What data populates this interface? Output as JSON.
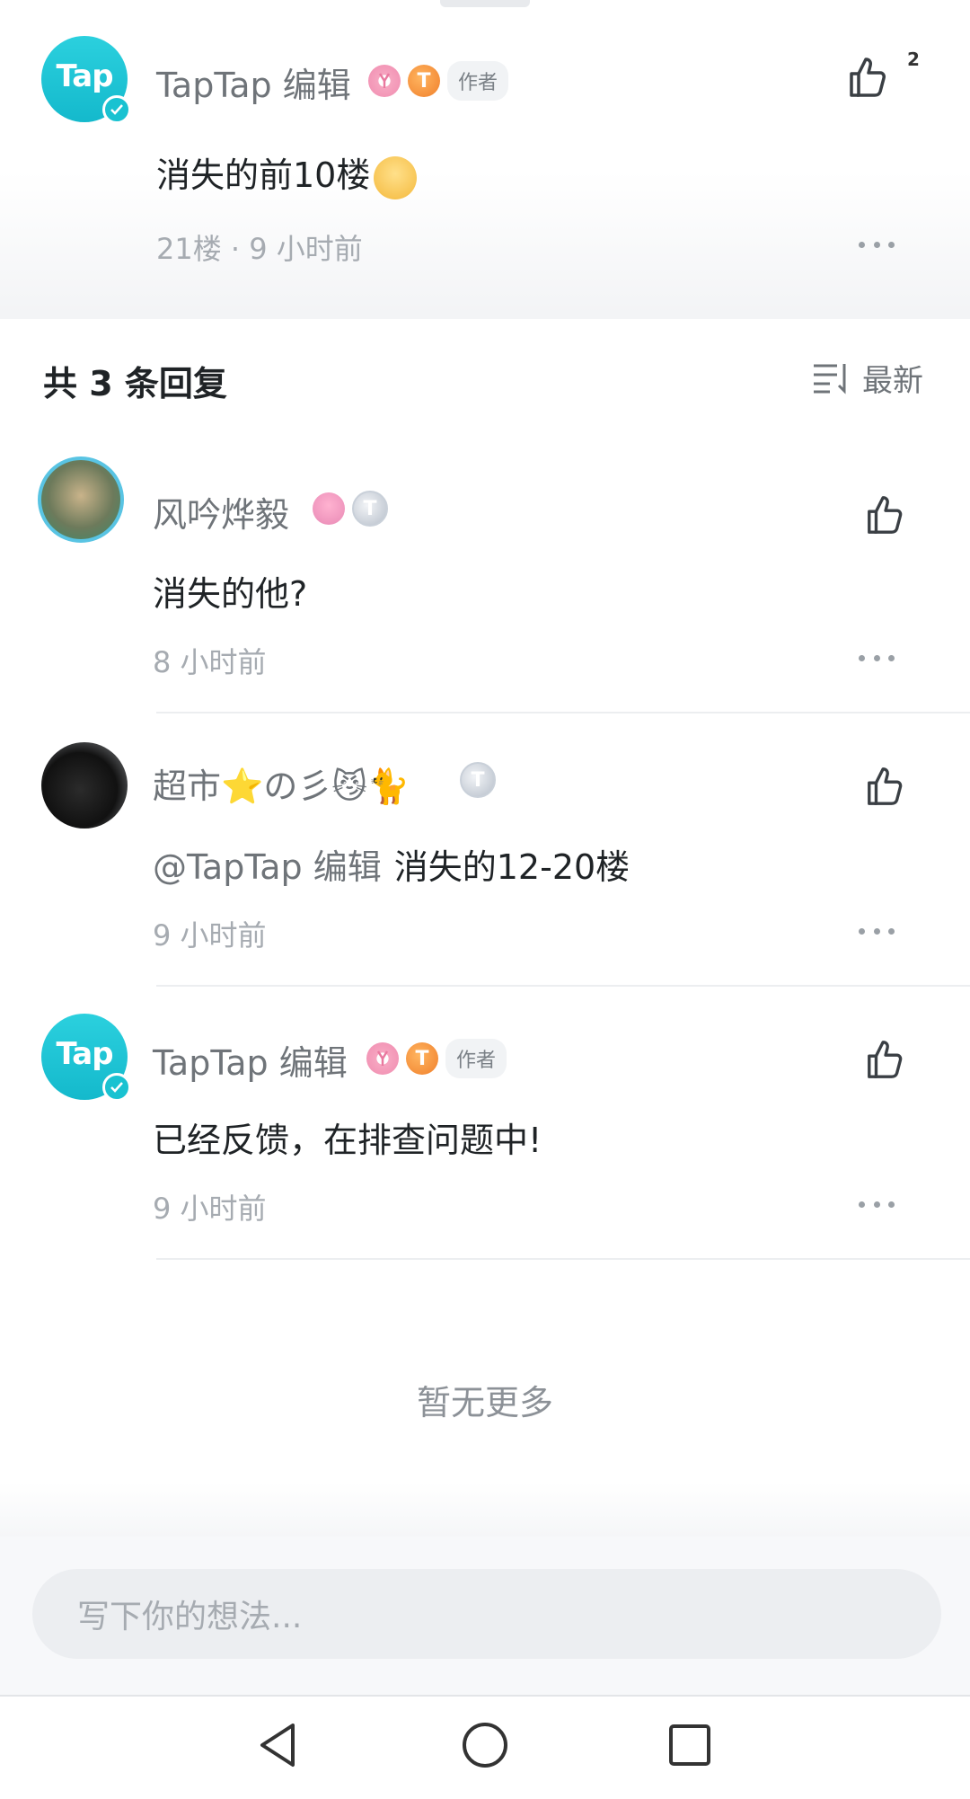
{
  "op": {
    "author": "TapTap 编辑",
    "avatar_text": "Tap",
    "author_tag": "作者",
    "medal_text": "T",
    "content": "消失的前10楼",
    "meta": "21楼 · 9 小时前",
    "like_count": "2"
  },
  "replies_header": {
    "title": "共 3 条回复",
    "sort_label": "最新"
  },
  "replies": [
    {
      "author": "风吟烨毅",
      "content": "消失的他?",
      "meta": "8 小时前",
      "medal_text": "T"
    },
    {
      "author": "超市⭐の彡😼🐈",
      "mention": "@TapTap 编辑",
      "content": "消失的12-20楼",
      "meta": "9 小时前",
      "medal_text": "T"
    },
    {
      "author": "TapTap 编辑",
      "avatar_text": "Tap",
      "author_tag": "作者",
      "content": "已经反馈，在排查问题中!",
      "meta": "9 小时前",
      "medal_text": "T"
    }
  ],
  "footer": {
    "no_more": "暂无更多",
    "composer_placeholder": "写下你的想法..."
  },
  "icons": {
    "like": "thumbs-up-icon",
    "more": "more-horizontal-icon",
    "sort": "sort-lines-icon",
    "nav_back": "triangle-back-icon",
    "nav_home": "circle-home-icon",
    "nav_recent": "square-recent-icon"
  },
  "colors": {
    "brand": "#14b9cc",
    "meta_text": "#a6abb1",
    "name_text": "#6f7479"
  }
}
